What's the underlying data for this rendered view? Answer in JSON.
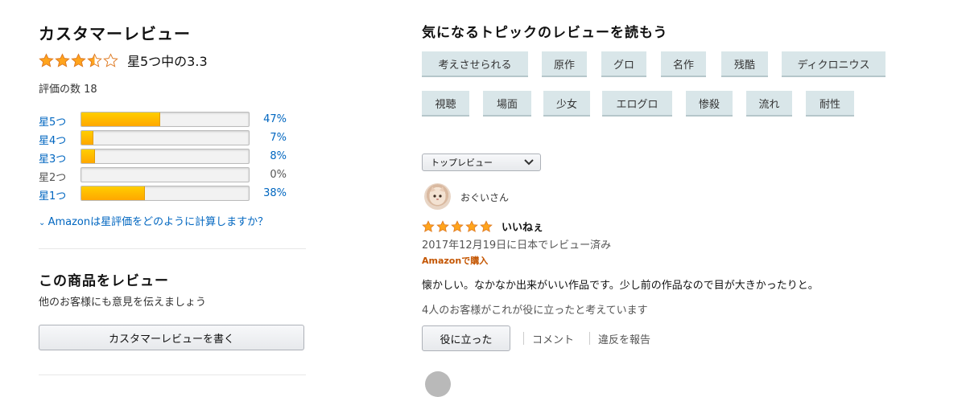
{
  "ratings": {
    "title": "カスタマーレビュー",
    "average_text": "星5つ中の3.3",
    "average_value": 3.3,
    "count_text": "評価の数 18",
    "histogram": [
      {
        "label": "星5つ",
        "percent_text": "47%",
        "percent": 47,
        "linked": true
      },
      {
        "label": "星4つ",
        "percent_text": "7%",
        "percent": 7,
        "linked": true
      },
      {
        "label": "星3つ",
        "percent_text": "8%",
        "percent": 8,
        "linked": true
      },
      {
        "label": "星2つ",
        "percent_text": "0%",
        "percent": 0,
        "linked": false
      },
      {
        "label": "星1つ",
        "percent_text": "38%",
        "percent": 38,
        "linked": true
      }
    ],
    "how_link": "Amazonは星評価をどのように計算しますか？"
  },
  "write_review": {
    "title": "この商品をレビュー",
    "subtitle": "他のお客様にも意見を伝えましょう",
    "button": "カスタマーレビューを書く"
  },
  "topics": {
    "title": "気になるトピックのレビューを読もう",
    "chips": [
      "考えさせられる",
      "原作",
      "グロ",
      "名作",
      "残酷",
      "ディクロニウス",
      "視聴",
      "場面",
      "少女",
      "エログロ",
      "惨殺",
      "流れ",
      "耐性"
    ]
  },
  "sort": {
    "selected": "トップレビュー"
  },
  "review": {
    "reviewer": "おぐいさん",
    "stars": 5,
    "title": "いいねぇ",
    "date": "2017年12月19日に日本でレビュー済み",
    "badge": "Amazonで購入",
    "body": "懐かしい。なかなか出来がいい作品です。少し前の作品なので目が大きかったりと。",
    "helpful_count": "4人のお客様がこれが役に立ったと考えています",
    "helpful_button": "役に立った",
    "comment_link": "コメント",
    "report_link": "違反を報告"
  },
  "colors": {
    "star": "#ffa41c",
    "link": "#0066c0",
    "badge": "#c45500",
    "chip_bg": "#d9e6e9"
  }
}
